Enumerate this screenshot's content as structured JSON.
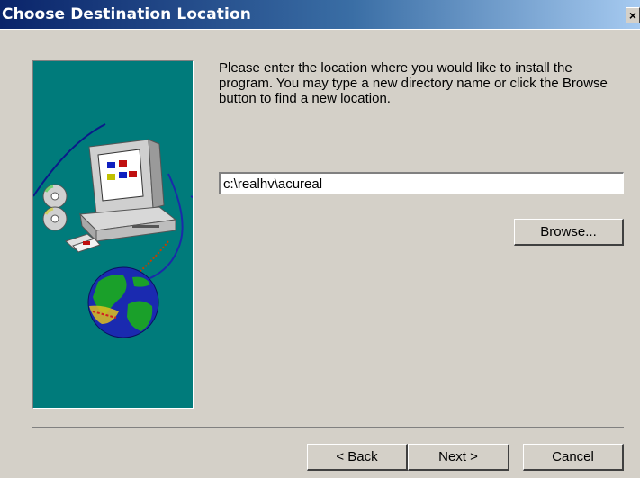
{
  "window": {
    "title": "Choose Destination Location",
    "close_glyph": "×"
  },
  "main": {
    "instructions": "Please enter the location where you would like to install the program.  You may type a new directory name or click the Browse button to find a new location.",
    "destination_path": "c:\\realhv\\acureal",
    "browse_label": "Browse..."
  },
  "footer": {
    "back_label": "< Back",
    "next_label": "Next >",
    "cancel_label": "Cancel"
  },
  "side_panel": {
    "icons": [
      "computer-icon",
      "cd-icon",
      "floppy-icon",
      "globe-icon"
    ]
  },
  "colors": {
    "title_bar": "#0a246a",
    "panel_bg": "#007b7b",
    "dialog_bg": "#d4d0c8"
  }
}
